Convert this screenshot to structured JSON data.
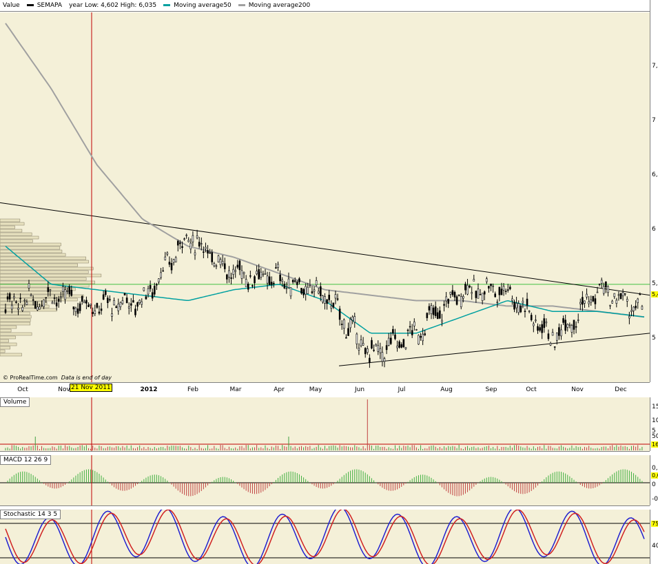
{
  "header": {
    "value_label": "Value",
    "ticker": "SEMAPA",
    "year_range": "year Low: 4,602  High: 6,035",
    "ma50_label": "Moving average50",
    "ma200_label": "Moving average200",
    "colors": {
      "price": "#000000",
      "ma50": "#00a0a0",
      "ma200": "#a0a0a0"
    }
  },
  "credit": {
    "source": "© ProRealTime.com",
    "note": "Data is end of day"
  },
  "cursor": {
    "date_label": "21 Nov 2011",
    "color": "#c00000"
  },
  "x_axis": {
    "labels": [
      "Oct",
      "Nov",
      "2012",
      "Feb",
      "Mar",
      "Apr",
      "May",
      "Jun",
      "Jul",
      "Aug",
      "Sep",
      "Oct",
      "Nov",
      "Dec"
    ]
  },
  "panels": {
    "volume": {
      "title": "Volume",
      "ticks": [
        "15",
        "10",
        "5",
        "50"
      ],
      "badge": "16"
    },
    "macd": {
      "title": "MACD 12 26 9",
      "ticks": [
        "0,1",
        "0",
        "-0"
      ],
      "badge": "0,0"
    },
    "stochastic": {
      "title": "Stochastic 14 3 5",
      "ticks": [
        "75",
        "40"
      ],
      "badge": "75"
    }
  },
  "chart_data": [
    {
      "type": "candlestick",
      "title": "SEMAPA",
      "period": "Sep 2011 – Dec 2012",
      "ylim": [
        4.6,
        8.0
      ],
      "y_ticks": [
        "7,5",
        "7",
        "6,5",
        "6",
        "5,5",
        "5"
      ],
      "last_value": "5,4",
      "close_by_month": [
        {
          "month": "Oct",
          "close": 5.3
        },
        {
          "month": "Nov",
          "close": 5.4
        },
        {
          "month": "Dec",
          "close": 5.3
        },
        {
          "month": "2012",
          "close": 5.35
        },
        {
          "month": "Feb",
          "close": 5.95
        },
        {
          "month": "Mar",
          "close": 5.6
        },
        {
          "month": "Apr",
          "close": 5.55
        },
        {
          "month": "May",
          "close": 5.4
        },
        {
          "month": "Jun",
          "close": 4.85
        },
        {
          "month": "Jul",
          "close": 5.05
        },
        {
          "month": "Aug",
          "close": 5.45
        },
        {
          "month": "Sep",
          "close": 5.45
        },
        {
          "month": "Oct",
          "close": 5.0
        },
        {
          "month": "Nov",
          "close": 5.45
        },
        {
          "month": "Dec",
          "close": 5.25
        }
      ],
      "ma50": [
        5.85,
        5.5,
        5.45,
        5.4,
        5.35,
        5.45,
        5.5,
        5.35,
        5.05,
        5.05,
        5.2,
        5.35,
        5.25,
        5.25,
        5.2
      ],
      "ma200": [
        7.9,
        7.3,
        6.6,
        6.1,
        5.85,
        5.75,
        5.6,
        5.45,
        5.4,
        5.35,
        5.35,
        5.3,
        5.3,
        5.25,
        5.2
      ],
      "trendlines": [
        {
          "name": "resistance",
          "from": 6.25,
          "to": 5.4
        },
        {
          "name": "support",
          "from": 4.75,
          "to": 5.05
        },
        {
          "name": "horizontal",
          "from": 5.5,
          "to": 5.5
        }
      ]
    },
    {
      "type": "bar",
      "title": "Volume",
      "note": "spike in Jun"
    },
    {
      "type": "bar",
      "title": "MACD 12 26 9"
    },
    {
      "type": "line",
      "title": "Stochastic 14 3 5",
      "ylim": [
        0,
        100
      ]
    }
  ]
}
